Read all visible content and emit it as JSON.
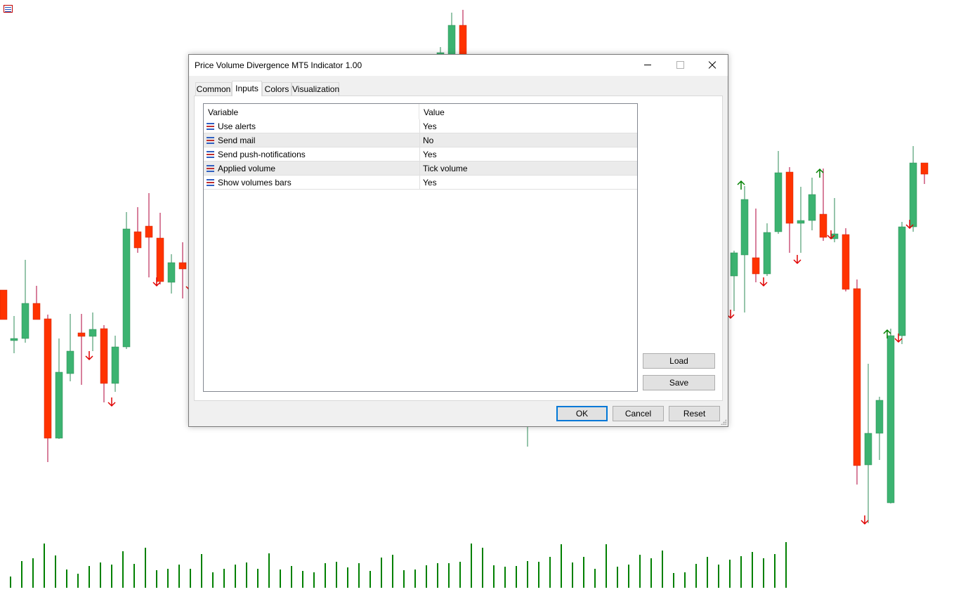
{
  "dialog": {
    "title": "Price Volume Divergence MT5 Indicator 1.00",
    "tabs": [
      {
        "label": "Common",
        "active": false
      },
      {
        "label": "Inputs",
        "active": true
      },
      {
        "label": "Colors",
        "active": false
      },
      {
        "label": "Visualization",
        "active": false
      }
    ],
    "table": {
      "headers": {
        "variable": "Variable",
        "value": "Value"
      },
      "rows": [
        {
          "variable": "Use alerts",
          "value": "Yes"
        },
        {
          "variable": "Send mail",
          "value": "No"
        },
        {
          "variable": "Send push-notifications",
          "value": "Yes"
        },
        {
          "variable": "Applied volume",
          "value": "Tick volume"
        },
        {
          "variable": "Show volumes bars",
          "value": "Yes"
        }
      ]
    },
    "side_buttons": {
      "load": "Load",
      "save": "Save"
    },
    "footer_buttons": {
      "ok": "OK",
      "cancel": "Cancel",
      "reset": "Reset"
    }
  },
  "colors": {
    "bull_candle": "#3cb371",
    "bear_candle": "#ff3300",
    "wick": "#b0003a",
    "up_arrow": "#008000",
    "down_arrow": "#e00000",
    "volume_bar": "#008000"
  },
  "icons": {
    "chart_menu": "chart-menu-icon",
    "param": "parameter-icon",
    "minimize": "minimize-icon",
    "maximize": "maximize-icon",
    "close": "close-icon"
  }
}
